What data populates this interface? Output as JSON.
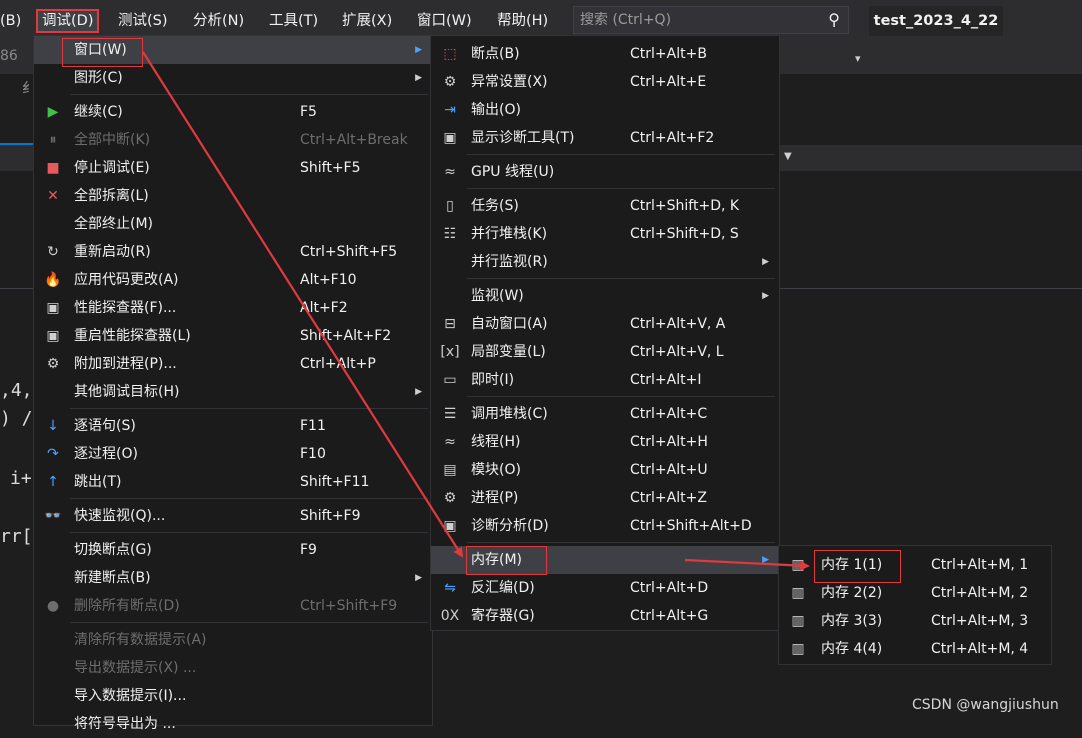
{
  "menubar": {
    "items": [
      "(B)",
      "调试(D)",
      "测试(S)",
      "分析(N)",
      "工具(T)",
      "扩展(X)",
      "窗口(W)",
      "帮助(H)"
    ],
    "search_placeholder": "搜索 (Ctrl+Q)",
    "window_title": "test_2023_4_22"
  },
  "background": {
    "line_num": "86",
    "fragment1": "纟",
    "code_lines": [
      ",4,",
      ") /",
      "i+",
      "rr["
    ]
  },
  "debug_menu": {
    "items": [
      {
        "icon": "",
        "label": "窗口(W)",
        "shortcut": "",
        "submenu": true
      },
      {
        "icon": "",
        "label": "图形(C)",
        "shortcut": "",
        "submenu": true
      },
      {
        "icon": "▶",
        "label": "继续(C)",
        "shortcut": "F5"
      },
      {
        "icon": "⏸",
        "label": "全部中断(K)",
        "shortcut": "Ctrl+Alt+Break",
        "disabled": true
      },
      {
        "icon": "■",
        "label": "停止调试(E)",
        "shortcut": "Shift+F5"
      },
      {
        "icon": "✕",
        "label": "全部拆离(L)",
        "shortcut": ""
      },
      {
        "icon": "",
        "label": "全部终止(M)",
        "shortcut": ""
      },
      {
        "icon": "↻",
        "label": "重新启动(R)",
        "shortcut": "Ctrl+Shift+F5"
      },
      {
        "icon": "🔥",
        "label": "应用代码更改(A)",
        "shortcut": "Alt+F10"
      },
      {
        "icon": "▣",
        "label": "性能探查器(F)...",
        "shortcut": "Alt+F2"
      },
      {
        "icon": "▣",
        "label": "重启性能探查器(L)",
        "shortcut": "Shift+Alt+F2"
      },
      {
        "icon": "⚙",
        "label": "附加到进程(P)...",
        "shortcut": "Ctrl+Alt+P"
      },
      {
        "icon": "",
        "label": "其他调试目标(H)",
        "shortcut": "",
        "submenu": true
      },
      {
        "icon": "↓",
        "label": "逐语句(S)",
        "shortcut": "F11"
      },
      {
        "icon": "↷",
        "label": "逐过程(O)",
        "shortcut": "F10"
      },
      {
        "icon": "↑",
        "label": "跳出(T)",
        "shortcut": "Shift+F11"
      },
      {
        "icon": "👓",
        "label": "快速监视(Q)...",
        "shortcut": "Shift+F9"
      },
      {
        "icon": "",
        "label": "切换断点(G)",
        "shortcut": "F9"
      },
      {
        "icon": "",
        "label": "新建断点(B)",
        "shortcut": "",
        "submenu": true
      },
      {
        "icon": "●",
        "label": "删除所有断点(D)",
        "shortcut": "Ctrl+Shift+F9",
        "disabled": true
      },
      {
        "icon": "",
        "label": "清除所有数据提示(A)",
        "shortcut": "",
        "disabled": true
      },
      {
        "icon": "",
        "label": "导出数据提示(X) ...",
        "shortcut": "",
        "disabled": true
      },
      {
        "icon": "",
        "label": "导入数据提示(I)...",
        "shortcut": ""
      },
      {
        "icon": "",
        "label": "将符号导出为 ...",
        "shortcut": ""
      }
    ]
  },
  "window_menu": {
    "items": [
      {
        "icon": "⬚",
        "label": "断点(B)",
        "shortcut": "Ctrl+Alt+B"
      },
      {
        "icon": "⚙",
        "label": "异常设置(X)",
        "shortcut": "Ctrl+Alt+E"
      },
      {
        "icon": "⇥",
        "label": "输出(O)",
        "shortcut": ""
      },
      {
        "icon": "▣",
        "label": "显示诊断工具(T)",
        "shortcut": "Ctrl+Alt+F2"
      },
      {
        "icon": "≈",
        "label": "GPU 线程(U)",
        "shortcut": ""
      },
      {
        "icon": "▯",
        "label": "任务(S)",
        "shortcut": "Ctrl+Shift+D, K"
      },
      {
        "icon": "☷",
        "label": "并行堆栈(K)",
        "shortcut": "Ctrl+Shift+D, S"
      },
      {
        "icon": "",
        "label": "并行监视(R)",
        "shortcut": "",
        "submenu": true
      },
      {
        "icon": "",
        "label": "监视(W)",
        "shortcut": "",
        "submenu": true
      },
      {
        "icon": "⊟",
        "label": "自动窗口(A)",
        "shortcut": "Ctrl+Alt+V, A"
      },
      {
        "icon": "[x]",
        "label": "局部变量(L)",
        "shortcut": "Ctrl+Alt+V, L"
      },
      {
        "icon": "▭",
        "label": "即时(I)",
        "shortcut": "Ctrl+Alt+I"
      },
      {
        "icon": "☰",
        "label": "调用堆栈(C)",
        "shortcut": "Ctrl+Alt+C"
      },
      {
        "icon": "≈",
        "label": "线程(H)",
        "shortcut": "Ctrl+Alt+H"
      },
      {
        "icon": "▤",
        "label": "模块(O)",
        "shortcut": "Ctrl+Alt+U"
      },
      {
        "icon": "⚙",
        "label": "进程(P)",
        "shortcut": "Ctrl+Alt+Z"
      },
      {
        "icon": "▣",
        "label": "诊断分析(D)",
        "shortcut": "Ctrl+Shift+Alt+D"
      },
      {
        "icon": "",
        "label": "内存(M)",
        "shortcut": "",
        "submenu": true
      },
      {
        "icon": "⇋",
        "label": "反汇编(D)",
        "shortcut": "Ctrl+Alt+D"
      },
      {
        "icon": "0X",
        "label": "寄存器(G)",
        "shortcut": "Ctrl+Alt+G"
      }
    ]
  },
  "memory_menu": {
    "items": [
      {
        "label": "内存 1(1)",
        "shortcut": "Ctrl+Alt+M, 1"
      },
      {
        "label": "内存 2(2)",
        "shortcut": "Ctrl+Alt+M, 2"
      },
      {
        "label": "内存 3(3)",
        "shortcut": "Ctrl+Alt+M, 3"
      },
      {
        "label": "内存 4(4)",
        "shortcut": "Ctrl+Alt+M, 4"
      }
    ]
  },
  "watermark": "CSDN @wangjiushun",
  "colors": {
    "annotation": "#e0393e",
    "menu_bg": "#1b1b1c",
    "highlight": "#3f3f46",
    "accent": "#007acc"
  }
}
